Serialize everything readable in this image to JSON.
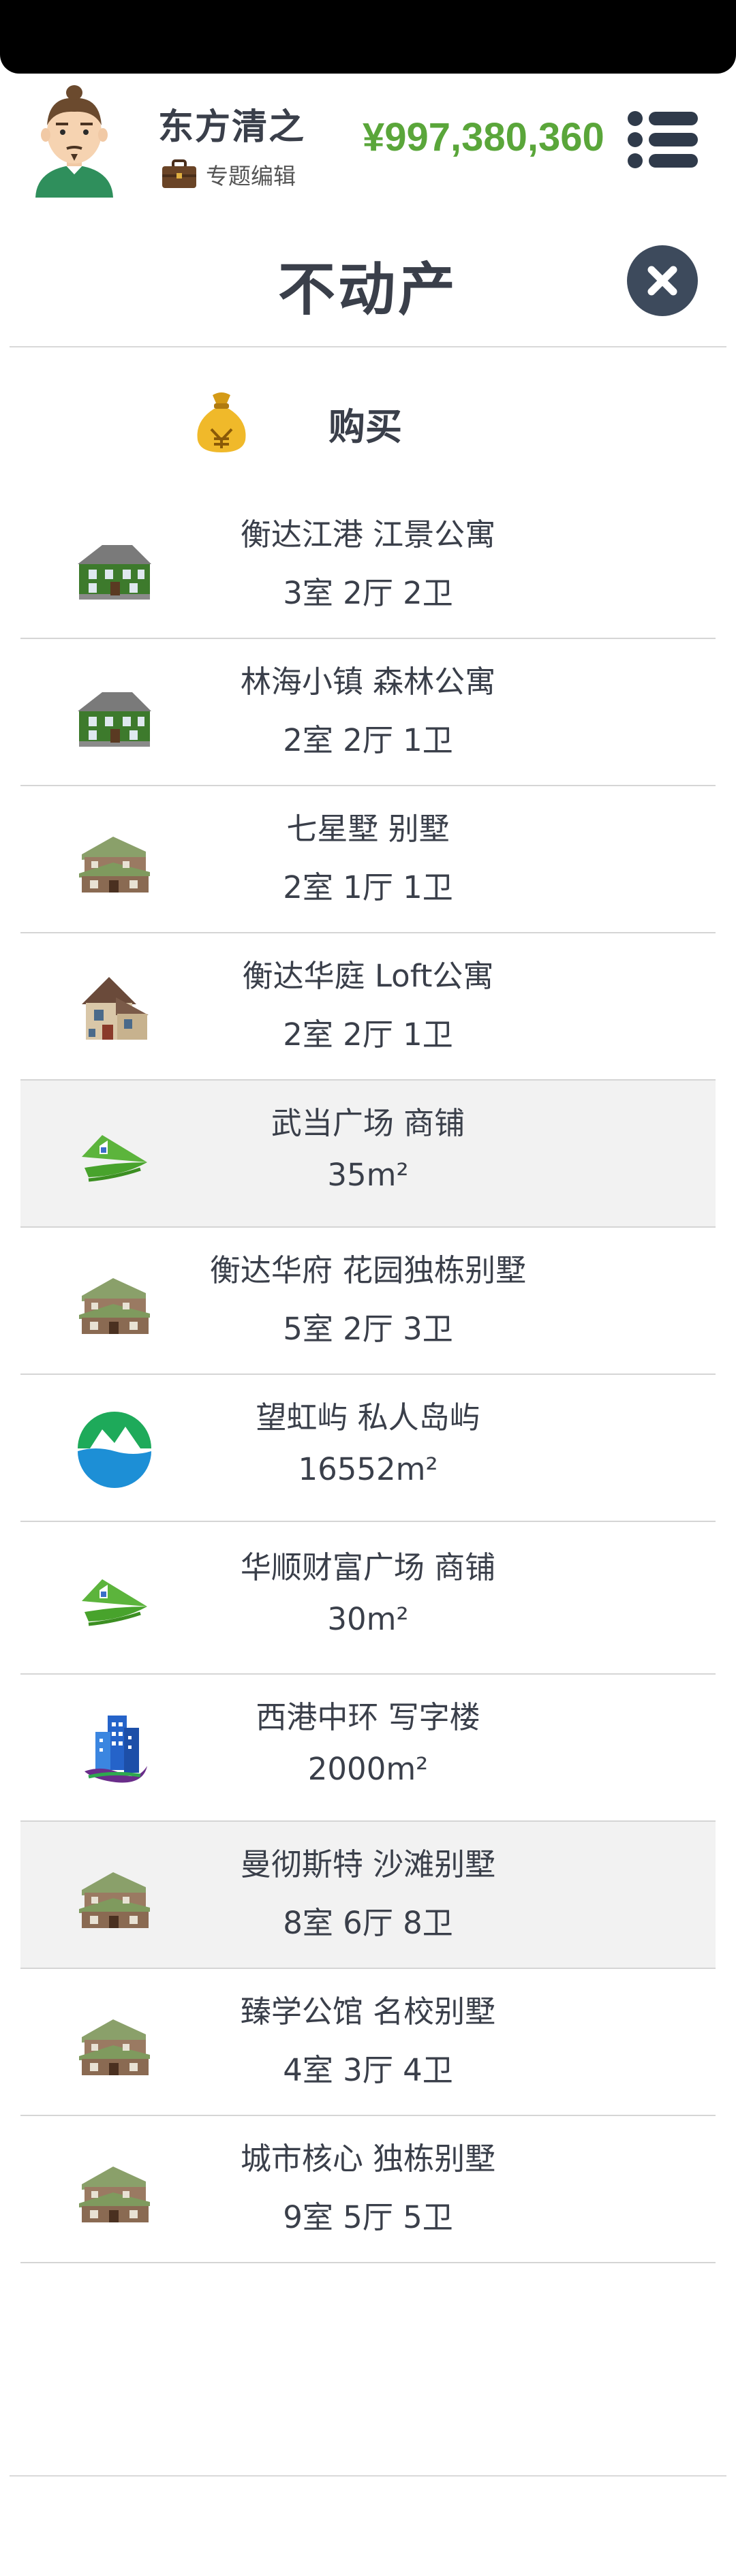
{
  "header": {
    "player_name": "东方清之",
    "edit_label": "专题编辑",
    "money": "¥997,380,360"
  },
  "modal": {
    "title": "不动产",
    "buy_label": "购买"
  },
  "properties": [
    {
      "name": "衡达江港 江景公寓",
      "detail": "3室 2厅 2卫",
      "icon": "green-villa-icon",
      "highlighted": false
    },
    {
      "name": "林海小镇 森林公寓",
      "detail": "2室 2厅 1卫",
      "icon": "green-villa-icon",
      "highlighted": false
    },
    {
      "name": "七星墅 别墅",
      "detail": "2室 1厅 1卫",
      "icon": "brown-house-icon",
      "highlighted": false
    },
    {
      "name": "衡达华庭 Loft公寓",
      "detail": "2室 2厅 1卫",
      "icon": "cottage-icon",
      "highlighted": false
    },
    {
      "name": "武当广场 商铺",
      "detail": "35m²",
      "icon": "green-roof-logo-icon",
      "highlighted": true
    },
    {
      "name": "衡达华府 花园独栋别墅",
      "detail": "5室 2厅 3卫",
      "icon": "brown-house-icon",
      "highlighted": false
    },
    {
      "name": "望虹屿 私人岛屿",
      "detail": "16552m²",
      "icon": "island-icon",
      "highlighted": false
    },
    {
      "name": "华顺财富广场 商铺",
      "detail": "30m²",
      "icon": "green-roof-logo-icon",
      "highlighted": false
    },
    {
      "name": "西港中环 写字楼",
      "detail": "2000m²",
      "icon": "office-building-icon",
      "highlighted": false
    },
    {
      "name": "曼彻斯特 沙滩别墅",
      "detail": "8室 6厅 8卫",
      "icon": "brown-house-icon",
      "highlighted": true
    },
    {
      "name": "臻学公馆 名校别墅",
      "detail": "4室 3厅 4卫",
      "icon": "brown-house-icon",
      "highlighted": false
    },
    {
      "name": "城市核心 独栋别墅",
      "detail": "9室 5厅 5卫",
      "icon": "brown-house-icon",
      "highlighted": false
    }
  ],
  "colors": {
    "money_green": "#5aa63a",
    "text_dark": "#3a3f4a",
    "close_button": "#3d4a5c",
    "highlight_row": "#f2f2f2"
  }
}
